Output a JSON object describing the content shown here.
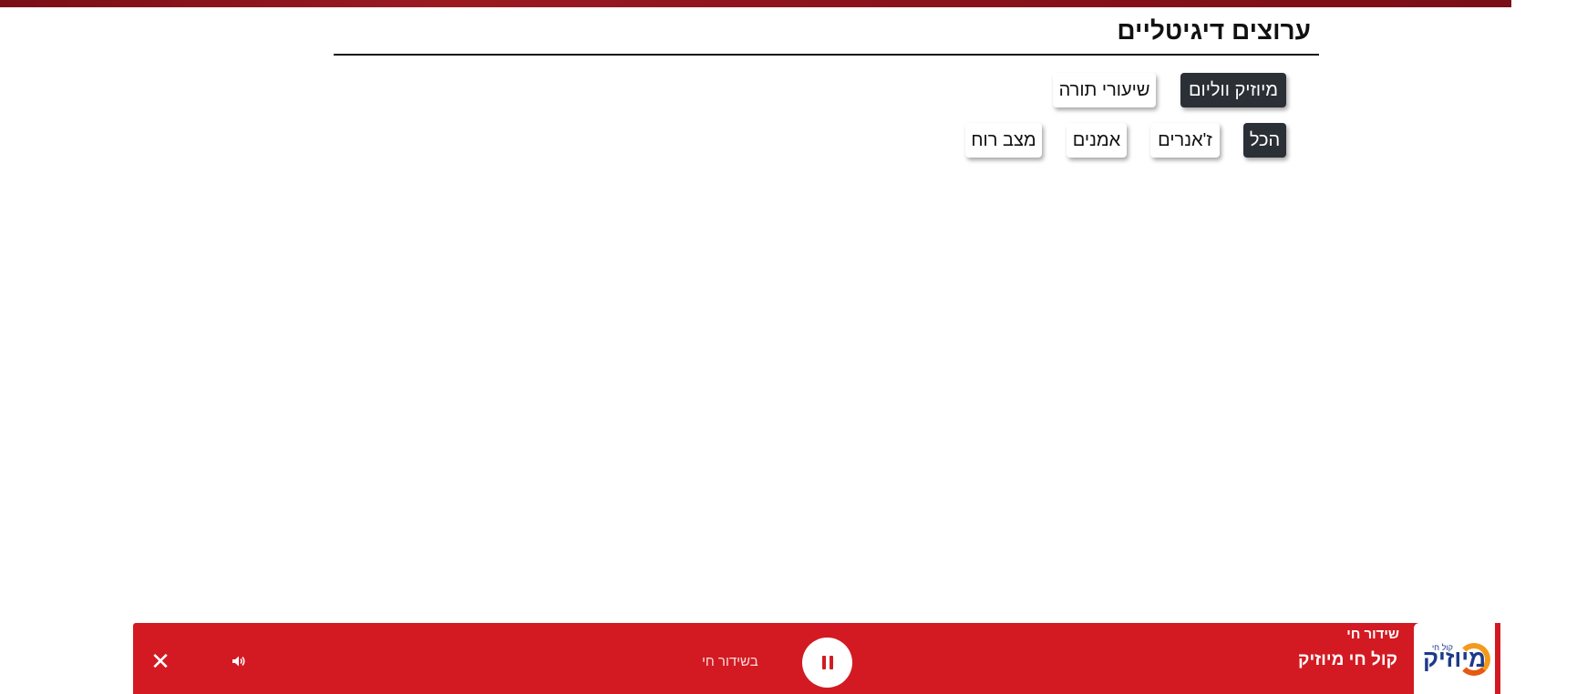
{
  "section": {
    "title": "ערוצים דיגיטליים"
  },
  "categories": [
    {
      "label": "מיוזיק ווליום",
      "active": true
    },
    {
      "label": "שיעורי תורה",
      "active": false
    }
  ],
  "filters": [
    {
      "label": "הכל",
      "active": true
    },
    {
      "label": "ז'אנרים",
      "active": false
    },
    {
      "label": "אמנים",
      "active": false
    },
    {
      "label": "מצב רוח",
      "active": false
    }
  ],
  "player": {
    "logo_small": "קול חי",
    "logo_text": "מיוזיק",
    "live_label": "שידור חי",
    "station_name": "קול חי מיוזיק",
    "status_text": "בשידור חי",
    "play_icon": "pause-icon",
    "volume_icon": "volume-icon",
    "close_icon": "close-icon",
    "close_glyph": "✕",
    "accent_color": "#d31a22"
  },
  "colors": {
    "header_band": "#8a121b",
    "active_chip": "#2b2f36"
  }
}
